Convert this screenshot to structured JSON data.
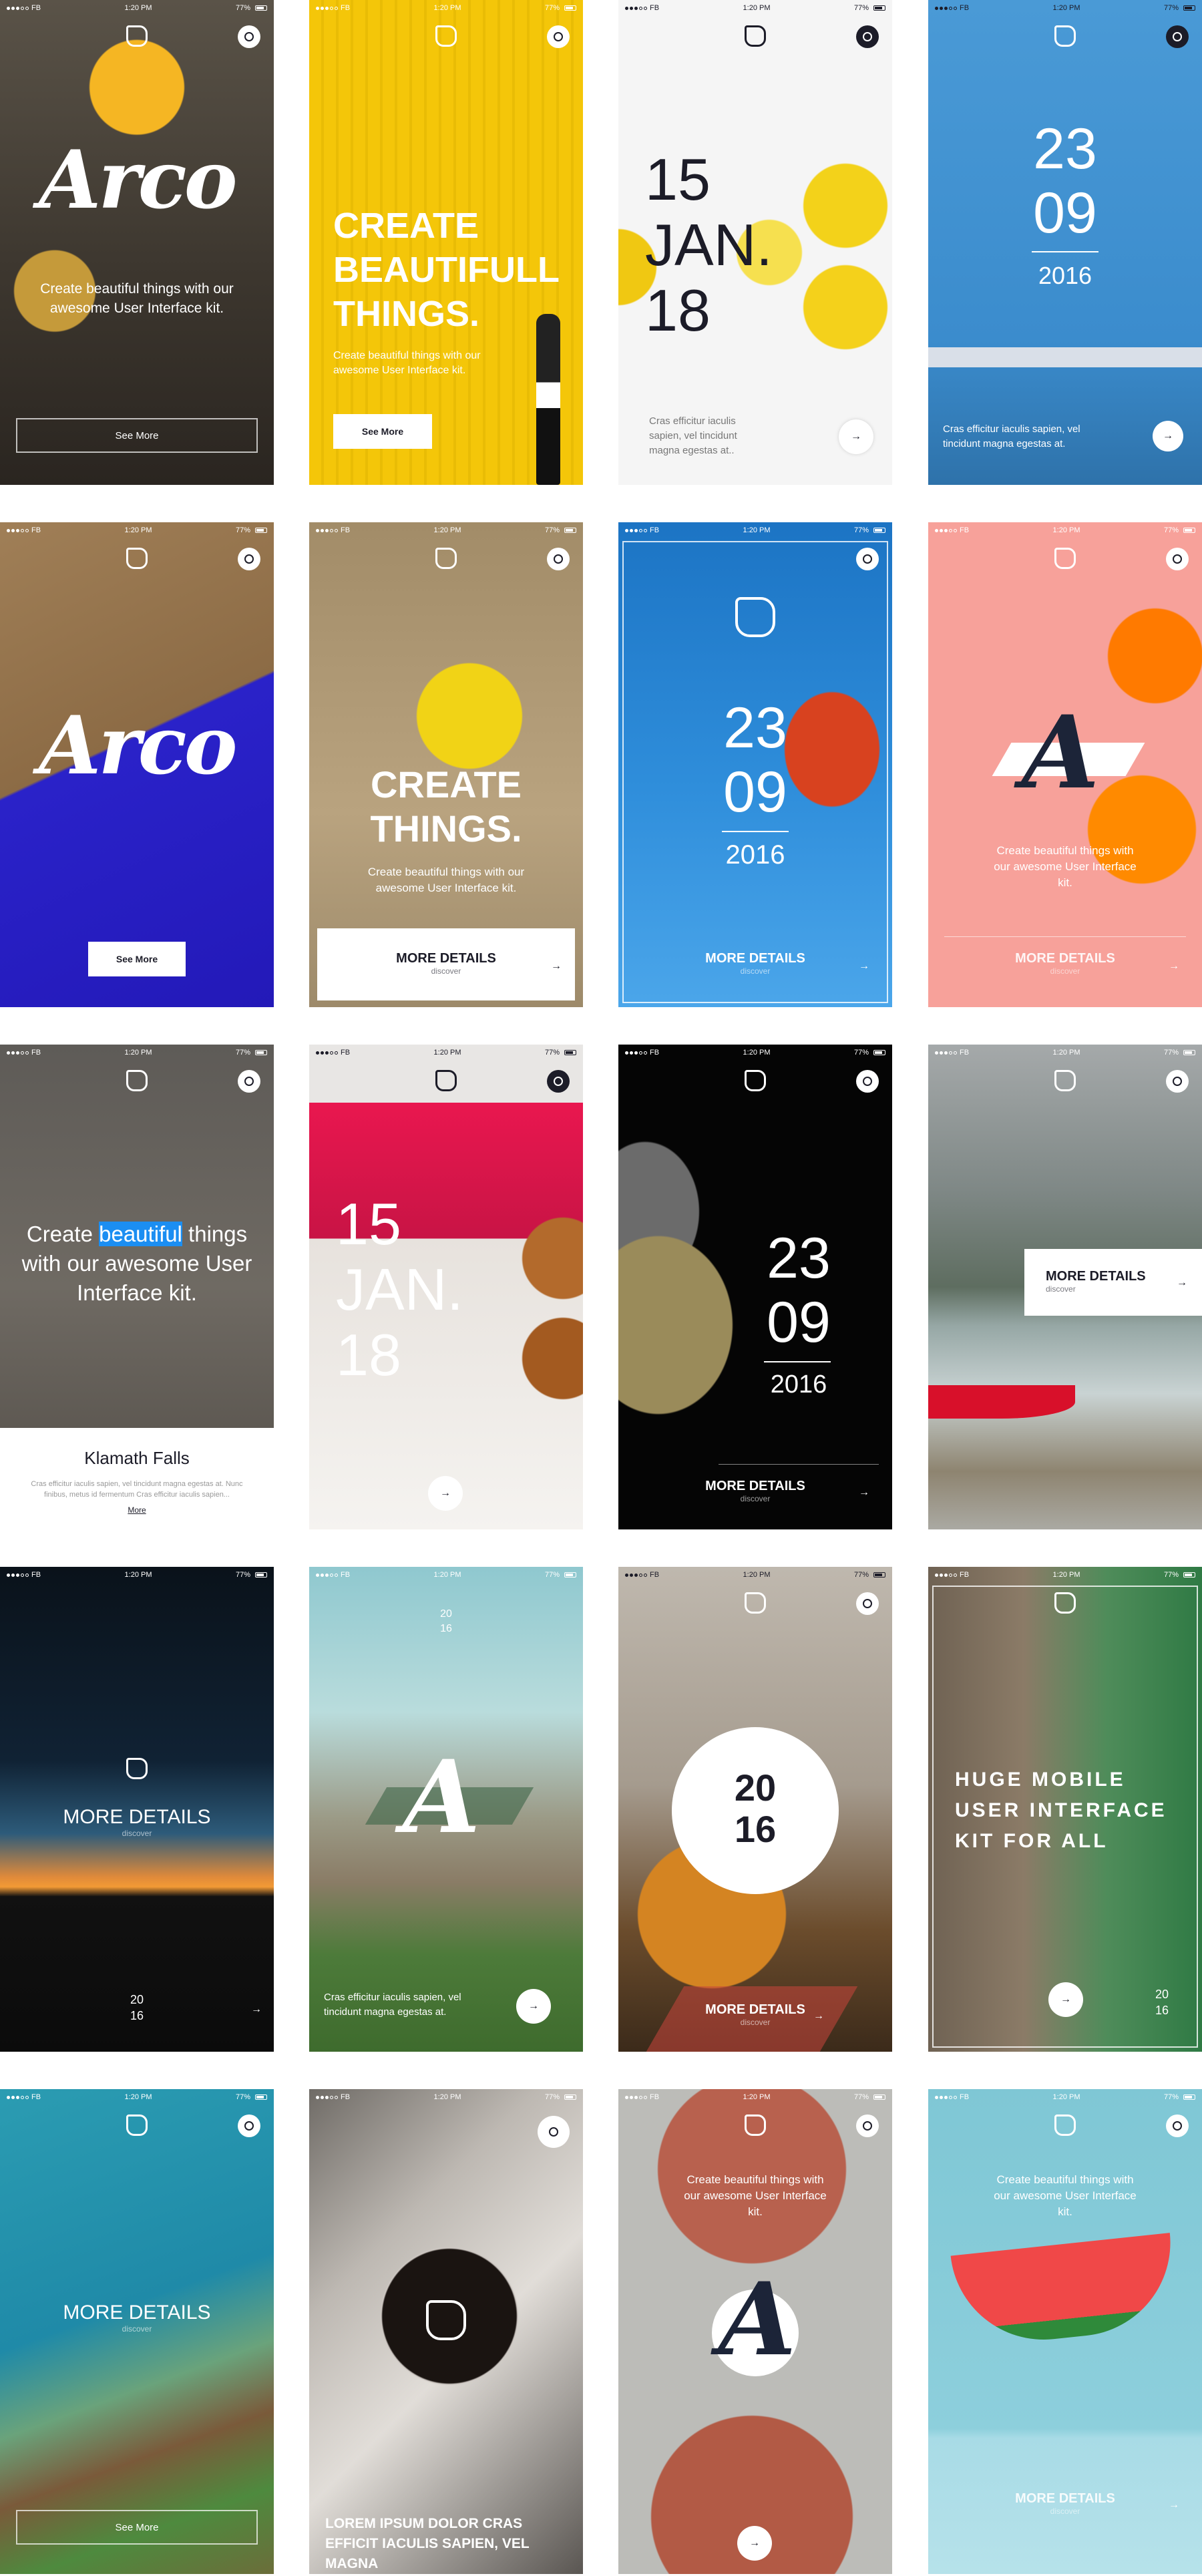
{
  "status": {
    "carrier": "FB",
    "time": "1:20 PM",
    "battery": "77%"
  },
  "icons": {
    "logo": "rounded-square-logo-icon",
    "search": "search-icon",
    "arrow": "arrow-right-icon"
  },
  "arrow_glyph": "→",
  "screens": {
    "s1": {
      "title": "Arco",
      "text": "Create beautiful things with our awesome User Interface kit.",
      "button": "See More"
    },
    "s2": {
      "title_1": "CREATE",
      "title_2": "BEAUTIFULL",
      "title_3": "THINGS.",
      "text": "Create beautiful things with our awesome User Interface kit.",
      "button": "See More"
    },
    "s3": {
      "day": "15",
      "month": "JAN.",
      "year": "18",
      "text": "Cras efficitur iaculis sapien, vel tincidunt magna egestas at.."
    },
    "s4": {
      "day": "23",
      "month": "09",
      "year": "2016",
      "text": "Cras efficitur iaculis sapien, vel tincidunt magna egestas at."
    },
    "s5": {
      "title": "Arco",
      "button": "See More"
    },
    "s6": {
      "title_1": "CREATE",
      "title_2": "THINGS.",
      "text": "Create beautiful things with our awesome User Interface kit.",
      "more": "MORE DETAILS",
      "sub": "discover"
    },
    "s7": {
      "day": "23",
      "month": "09",
      "year": "2016",
      "more": "MORE DETAILS",
      "sub": "discover"
    },
    "s8": {
      "letter": "A",
      "text": "Create beautiful things with our awesome User Interface kit.",
      "more": "MORE DETAILS",
      "sub": "discover"
    },
    "s9": {
      "pre": "Create ",
      "highlight": "beautiful",
      "post": " things with our awesome User Interface kit.",
      "card_title": "Klamath Falls",
      "card_text": "Cras efficitur iaculis sapien, vel tincidunt magna egestas at. Nunc finibus, metus id fermentum Cras efficitur iaculis sapien...",
      "card_link": "More"
    },
    "s10": {
      "day": "15",
      "month": "JAN.",
      "year": "18"
    },
    "s11": {
      "day": "23",
      "month": "09",
      "year": "2016",
      "more": "MORE DETAILS",
      "sub": "discover"
    },
    "s12": {
      "more": "MORE DETAILS",
      "sub": "discover"
    },
    "s13": {
      "more": "MORE DETAILS",
      "sub": "discover",
      "year_1": "20",
      "year_2": "16"
    },
    "s14": {
      "year_1": "20",
      "year_2": "16",
      "letter": "A",
      "text": "Cras efficitur iaculis sapien, vel tincidunt magna egestas at."
    },
    "s15": {
      "year_1": "20",
      "year_2": "16",
      "more": "MORE DETAILS",
      "sub": "discover"
    },
    "s16": {
      "line_1": "HUGE MOBILE",
      "line_2": "USER INTERFACE",
      "line_3": "KIT FOR ALL",
      "year_1": "20",
      "year_2": "16"
    },
    "s17": {
      "more": "MORE DETAILS",
      "sub": "discover",
      "button": "See More"
    },
    "s18": {
      "text": "LOREM IPSUM DOLOR CRAS EFFICIT IACULIS SAPIEN, VEL MAGNA"
    },
    "s19": {
      "text": "Create beautiful things with our awesome User Interface kit.",
      "letter": "A"
    },
    "s20": {
      "text": "Create beautiful things with our awesome User Interface kit.",
      "more": "MORE DETAILS",
      "sub": "discover"
    }
  }
}
